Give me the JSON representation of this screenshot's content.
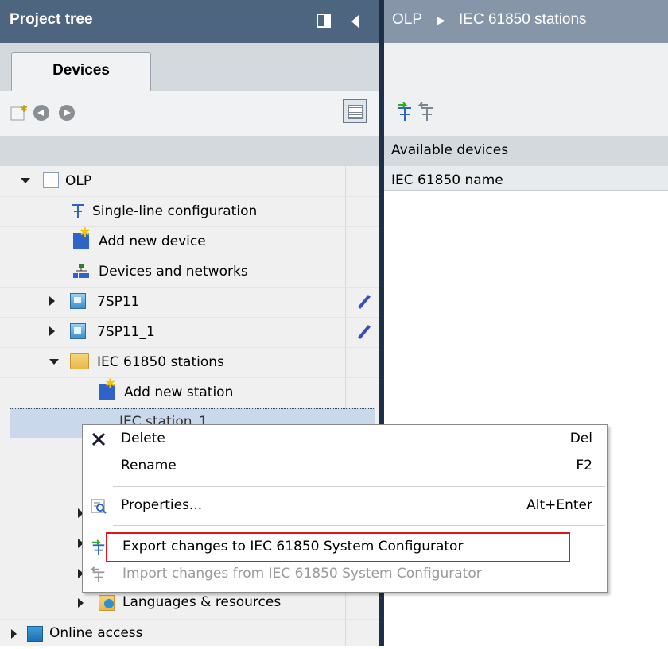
{
  "left_panel": {
    "title": "Project tree",
    "tab": "Devices"
  },
  "tree": {
    "root": "OLP",
    "items": [
      {
        "label": "Single-line configuration"
      },
      {
        "label": "Add new device"
      },
      {
        "label": "Devices and networks"
      },
      {
        "label": "7SP11"
      },
      {
        "label": "7SP11_1"
      },
      {
        "label": "IEC 61850 stations"
      },
      {
        "label": "Add new station"
      },
      {
        "label": "IEC station_1"
      },
      {
        "label": "Languages & resources"
      },
      {
        "label": "Online access"
      }
    ]
  },
  "right_panel": {
    "breadcrumb": [
      "OLP",
      "IEC 61850 stations"
    ],
    "available_devices": "Available devices",
    "column_header": "IEC 61850 name"
  },
  "context_menu": {
    "items": [
      {
        "label": "Delete",
        "shortcut": "Del"
      },
      {
        "label": "Rename",
        "shortcut": "F2"
      },
      {
        "label": "Properties...",
        "shortcut": "Alt+Enter"
      },
      {
        "label": "Export changes to IEC 61850 System Configurator",
        "shortcut": ""
      },
      {
        "label": "Import changes from IEC 61850 System Configurator",
        "shortcut": ""
      }
    ],
    "highlight_color": "#e0141e"
  },
  "colors": {
    "header_active": "#4e6580",
    "header_inactive": "#8696a8",
    "selection": "#c9d8ea"
  }
}
